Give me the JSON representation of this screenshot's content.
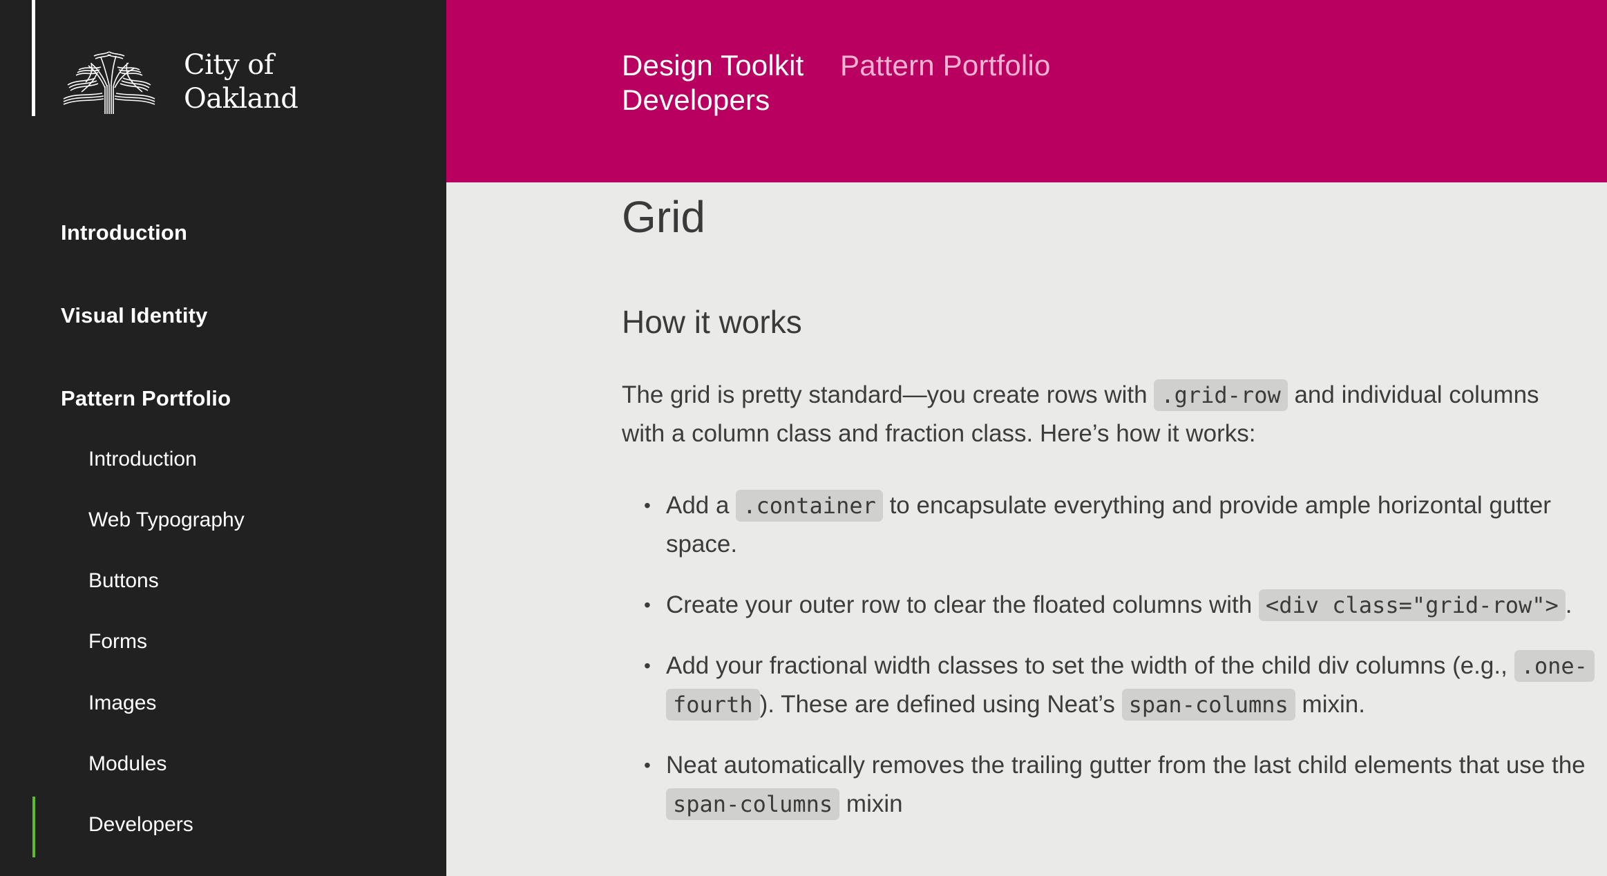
{
  "brand": {
    "name_line1": "City of",
    "name_line2": "Oakland",
    "logo_icon": "oak-tree-logo-icon"
  },
  "sidebar": {
    "items": [
      {
        "label": "Introduction"
      },
      {
        "label": "Visual Identity"
      },
      {
        "label": "Pattern Portfolio"
      }
    ],
    "sub_items": [
      {
        "label": "Introduction"
      },
      {
        "label": "Web Typography"
      },
      {
        "label": "Buttons"
      },
      {
        "label": "Forms"
      },
      {
        "label": "Images"
      },
      {
        "label": "Modules"
      },
      {
        "label": "Developers",
        "active": true
      }
    ],
    "active_indicator_color": "#5cbd27"
  },
  "header": {
    "background": "#b90060",
    "links": [
      {
        "label": "Design Toolkit"
      },
      {
        "label": "Pattern Portfolio",
        "current": true
      },
      {
        "label": "Developers"
      }
    ]
  },
  "main": {
    "title": "Grid",
    "section_title": "How it works",
    "intro": {
      "before": "The grid is pretty standard—you create rows with ",
      "code": ".grid-row",
      "after": " and individual columns with a column class and fraction class. Here’s how it works:"
    },
    "steps": [
      {
        "t1": "Add a ",
        "c1": ".container",
        "t2": " to encapsulate everything and provide ample horizontal gutter space."
      },
      {
        "t1": "Create your outer row to clear the floated columns with ",
        "c1": "<div class=\"grid-row\">",
        "t2": "."
      },
      {
        "t1": "Add your fractional width classes to set the width of the child div columns (e.g., ",
        "c1": ".one-fourth",
        "t2": "). These are defined using Neat’s ",
        "c2": "span-columns",
        "t3": " mixin."
      },
      {
        "t1": "Neat automatically removes the trailing gutter from the last child elements that use the ",
        "c1": "span-columns",
        "t2": " mixin"
      }
    ]
  }
}
